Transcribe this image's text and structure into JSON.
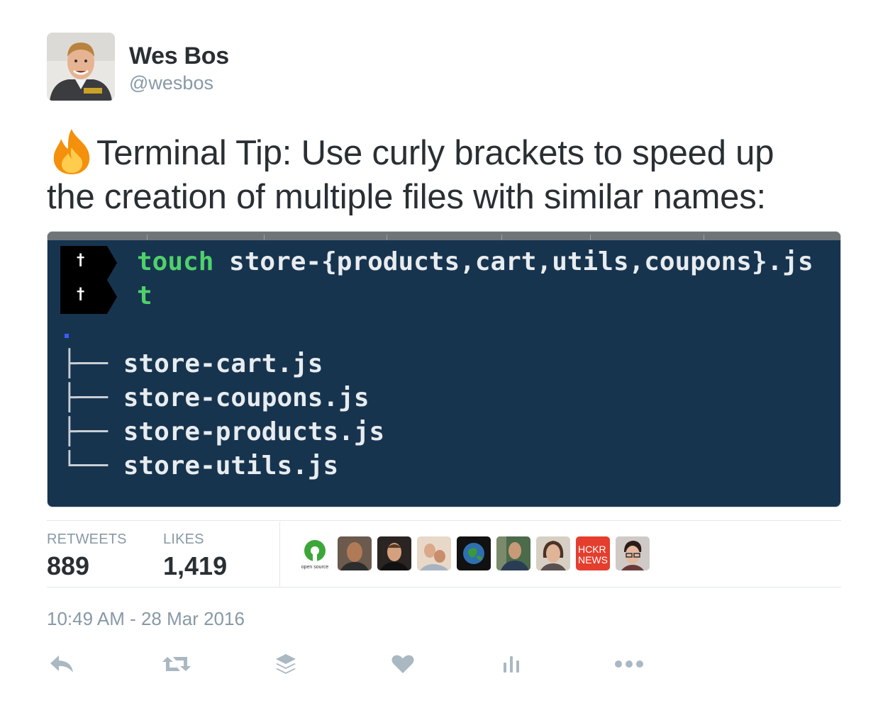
{
  "author": {
    "name": "Wes Bos",
    "handle": "@wesbos"
  },
  "tweet": {
    "emoji_icon": "fire-emoji",
    "text_line1": "Terminal Tip: Use curly brackets to speed up",
    "text_line2": "the creation of multiple files with similar names:"
  },
  "terminal": {
    "prompt_symbol": "†",
    "command_word": "touch",
    "command_args": " store-{products,cart,utils,coupons}.js",
    "second_line": "t",
    "tree_root": ".",
    "tree": [
      {
        "prefix": "├──",
        "file": "store-cart.js"
      },
      {
        "prefix": "├──",
        "file": "store-coupons.js"
      },
      {
        "prefix": "├──",
        "file": "store-products.js"
      },
      {
        "prefix": "└──",
        "file": "store-utils.js"
      }
    ],
    "colors": {
      "background": "#17344f",
      "command": "#4fd16a"
    }
  },
  "stats": {
    "retweets_label": "RETWEETS",
    "retweets_value": "889",
    "likes_label": "LIKES",
    "likes_value": "1,419"
  },
  "likers": {
    "open_source_label": "open source",
    "hckr_news_line1": "HCKR",
    "hckr_news_line2": "NEWS"
  },
  "timestamp": "10:49 AM - 28 Mar 2016",
  "actions": [
    "reply-icon",
    "retweet-icon",
    "buffer-icon",
    "like-icon",
    "analytics-icon",
    "more-icon"
  ],
  "accent_colors": {
    "meta_gray": "#8899a6",
    "text": "#292f33",
    "divider": "#e1e8ed"
  }
}
